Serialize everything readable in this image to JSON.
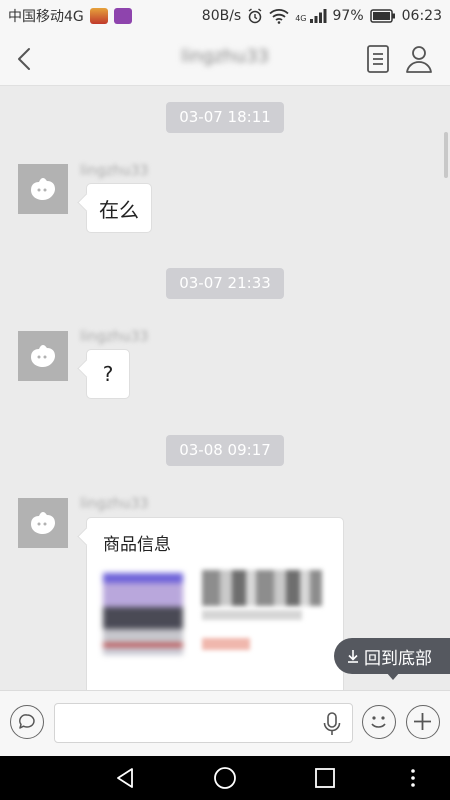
{
  "status_bar": {
    "carrier": "中国移动4G",
    "network_speed": "80B/s",
    "network_type": "4G",
    "battery": "97%",
    "time": "06:23"
  },
  "nav": {
    "title": "lingzhu33"
  },
  "messages": [
    {
      "timestamp": "03-07 18:11",
      "sender": "lingzhu33",
      "text": "在么"
    },
    {
      "timestamp": "03-07 21:33",
      "sender": "lingzhu33",
      "text": "?"
    },
    {
      "timestamp": "03-08 09:17",
      "sender": "lingzhu33",
      "card_title": "商品信息"
    }
  ],
  "scroll_to_bottom_label": "回到底部",
  "input": {
    "value": ""
  },
  "colors": {
    "background": "#ebebeb",
    "timestamp_bg": "#cfcfd3",
    "avatar_bg": "#b2b2b2",
    "button_dark": "#55585f"
  }
}
